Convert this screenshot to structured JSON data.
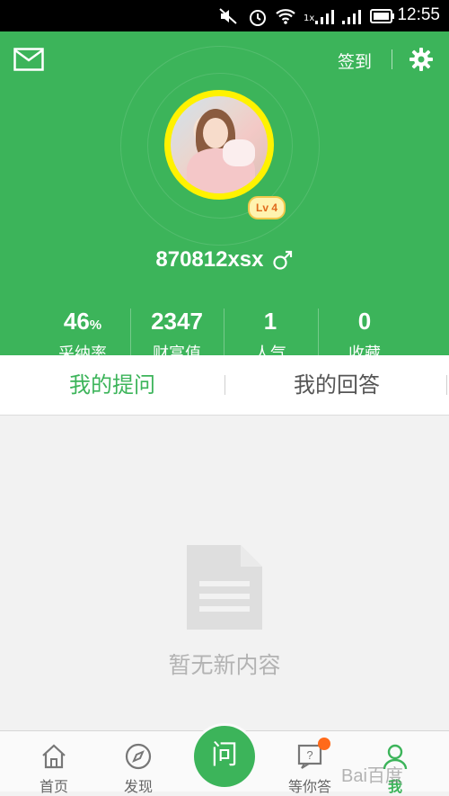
{
  "status_bar": {
    "time": "12:55",
    "network_label": "1x"
  },
  "header": {
    "signin_label": "签到",
    "icons": [
      "mail-icon",
      "gear-icon"
    ]
  },
  "profile": {
    "username": "870812xsx",
    "gender_symbol": "♂",
    "level_badge": "Lv 4",
    "stats": [
      {
        "value": "46",
        "unit": "%",
        "label": "采纳率"
      },
      {
        "value": "2347",
        "unit": "",
        "label": "财富值"
      },
      {
        "value": "1",
        "unit": "",
        "label": "人气"
      },
      {
        "value": "0",
        "unit": "",
        "label": "收藏"
      }
    ]
  },
  "tabs": [
    {
      "label": "我的提问",
      "active": true
    },
    {
      "label": "我的回答",
      "active": false
    }
  ],
  "empty_state": {
    "message": "暂无新内容",
    "icon": "document-icon"
  },
  "bottom_nav": {
    "items": [
      {
        "label": "首页",
        "icon": "home-icon"
      },
      {
        "label": "发现",
        "icon": "compass-icon"
      },
      {
        "label": "等你答",
        "icon": "question-icon"
      },
      {
        "label": "我",
        "icon": "person-icon",
        "active": true
      }
    ],
    "ask_label": "问"
  },
  "watermark": "Bai百度",
  "colors": {
    "brand_green": "#3cb45a",
    "badge_orange": "#ff6a1a",
    "avatar_ring": "#fff200"
  }
}
